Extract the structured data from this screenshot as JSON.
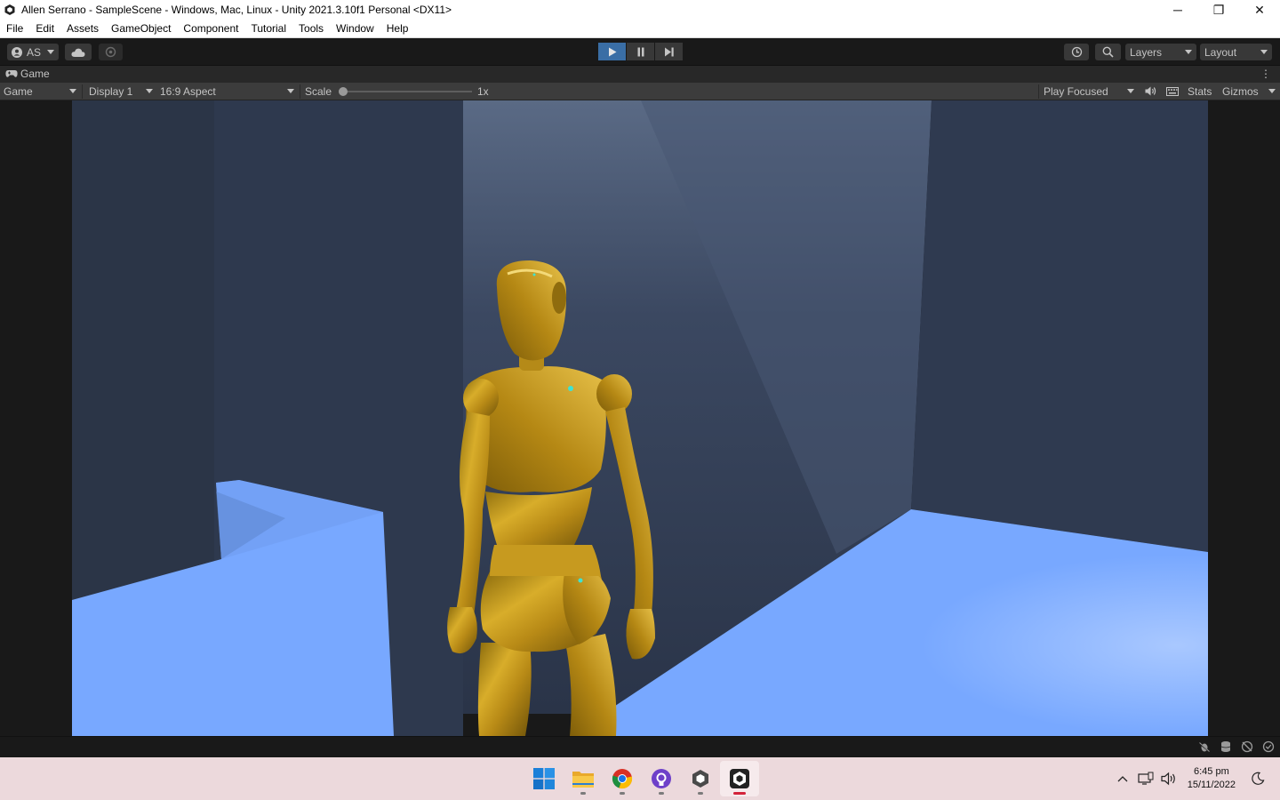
{
  "window": {
    "title": "Allen Serrano - SampleScene - Windows, Mac, Linux - Unity 2021.3.10f1 Personal <DX11>",
    "controls": {
      "minimize": "─",
      "restore": "❐",
      "close": "✕"
    }
  },
  "menu": [
    "File",
    "Edit",
    "Assets",
    "GameObject",
    "Component",
    "Tutorial",
    "Tools",
    "Window",
    "Help"
  ],
  "toolbar": {
    "account_label": "AS",
    "layers_label": "Layers",
    "layout_label": "Layout",
    "play_state": "playing"
  },
  "game_tab": {
    "label": "Game",
    "kebab": "⋮"
  },
  "game_controls": {
    "view_mode": "Game",
    "display": "Display 1",
    "aspect": "16:9 Aspect",
    "scale_label": "Scale",
    "scale_value": "1x",
    "play_mode": "Play Focused",
    "stats": "Stats",
    "gizmos": "Gizmos"
  },
  "taskbar": {
    "apps": [
      "windows-start",
      "file-explorer",
      "chrome",
      "github-desktop",
      "unity-hub",
      "unity-editor"
    ],
    "time": "6:45 pm",
    "date": "15/11/2022"
  },
  "colors": {
    "editor_bg": "#191919",
    "play_active": "#3a6ea5",
    "floor": "#78a8ff",
    "wall": "#2f3b52",
    "robot": "#c89a1c",
    "taskbar": "#ecd9dc"
  }
}
